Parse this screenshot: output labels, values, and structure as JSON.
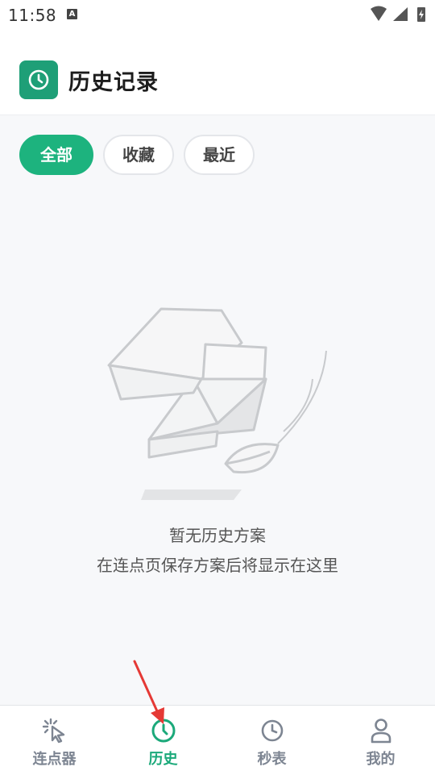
{
  "status_bar": {
    "time": "11:58",
    "badge": "A"
  },
  "header": {
    "title": "历史记录",
    "icon": "clock-icon"
  },
  "filters": [
    {
      "label": "全部",
      "active": true
    },
    {
      "label": "收藏",
      "active": false
    },
    {
      "label": "最近",
      "active": false
    }
  ],
  "empty_state": {
    "title": "暂无历史方案",
    "subtitle": "在连点页保存方案后将显示在这里",
    "icon": "empty-box-illustration"
  },
  "bottom_nav": [
    {
      "label": "连点器",
      "icon": "cursor-click-icon",
      "active": false
    },
    {
      "label": "历史",
      "icon": "clock-icon",
      "active": true
    },
    {
      "label": "秒表",
      "icon": "stopwatch-icon",
      "active": false
    },
    {
      "label": "我的",
      "icon": "user-icon",
      "active": false
    }
  ],
  "colors": {
    "accent": "#1db37e",
    "header_icon_bg": "#1e9f77",
    "arrow": "#e53935"
  }
}
